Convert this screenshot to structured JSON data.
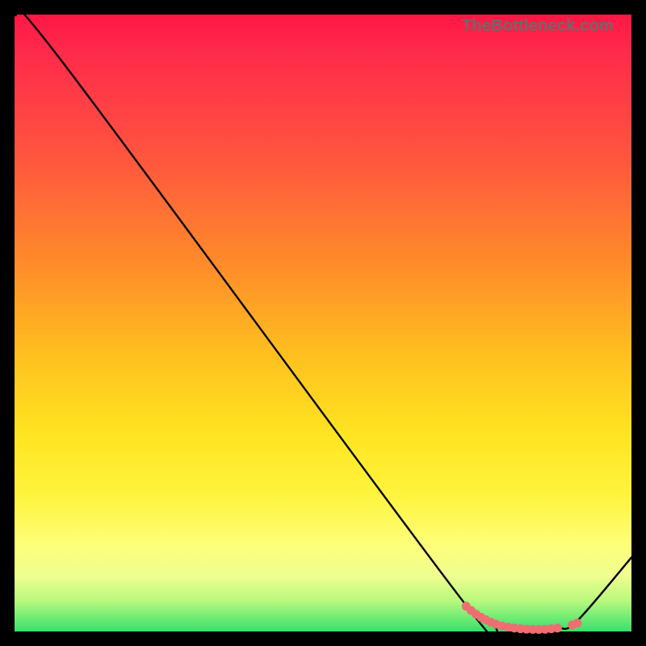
{
  "attribution": "TheBottleneck.com",
  "chart_data": {
    "type": "line",
    "title": "",
    "xlabel": "",
    "ylabel": "",
    "xlim": [
      0,
      100
    ],
    "ylim": [
      0,
      100
    ],
    "series": [
      {
        "name": "bottleneck-curve",
        "x": [
          0,
          8,
          73,
          78,
          82,
          85,
          88,
          91,
          100
        ],
        "y": [
          100,
          92,
          4.5,
          1.5,
          0.6,
          0.3,
          0.6,
          1.5,
          12
        ]
      }
    ],
    "markers": {
      "name": "optimal-range",
      "color": "#ef6e72",
      "points": [
        {
          "x": 73.2,
          "y": 4.1
        },
        {
          "x": 74.0,
          "y": 3.4
        },
        {
          "x": 74.8,
          "y": 2.8
        },
        {
          "x": 75.6,
          "y": 2.3
        },
        {
          "x": 76.4,
          "y": 1.9
        },
        {
          "x": 77.2,
          "y": 1.5
        },
        {
          "x": 78.0,
          "y": 1.2
        },
        {
          "x": 79.0,
          "y": 0.9
        },
        {
          "x": 80.0,
          "y": 0.7
        },
        {
          "x": 81.0,
          "y": 0.55
        },
        {
          "x": 82.0,
          "y": 0.45
        },
        {
          "x": 83.0,
          "y": 0.38
        },
        {
          "x": 84.0,
          "y": 0.34
        },
        {
          "x": 85.0,
          "y": 0.33
        },
        {
          "x": 86.0,
          "y": 0.36
        },
        {
          "x": 87.0,
          "y": 0.44
        },
        {
          "x": 88.0,
          "y": 0.55
        },
        {
          "x": 90.4,
          "y": 1.05
        },
        {
          "x": 91.2,
          "y": 1.35
        }
      ]
    }
  }
}
